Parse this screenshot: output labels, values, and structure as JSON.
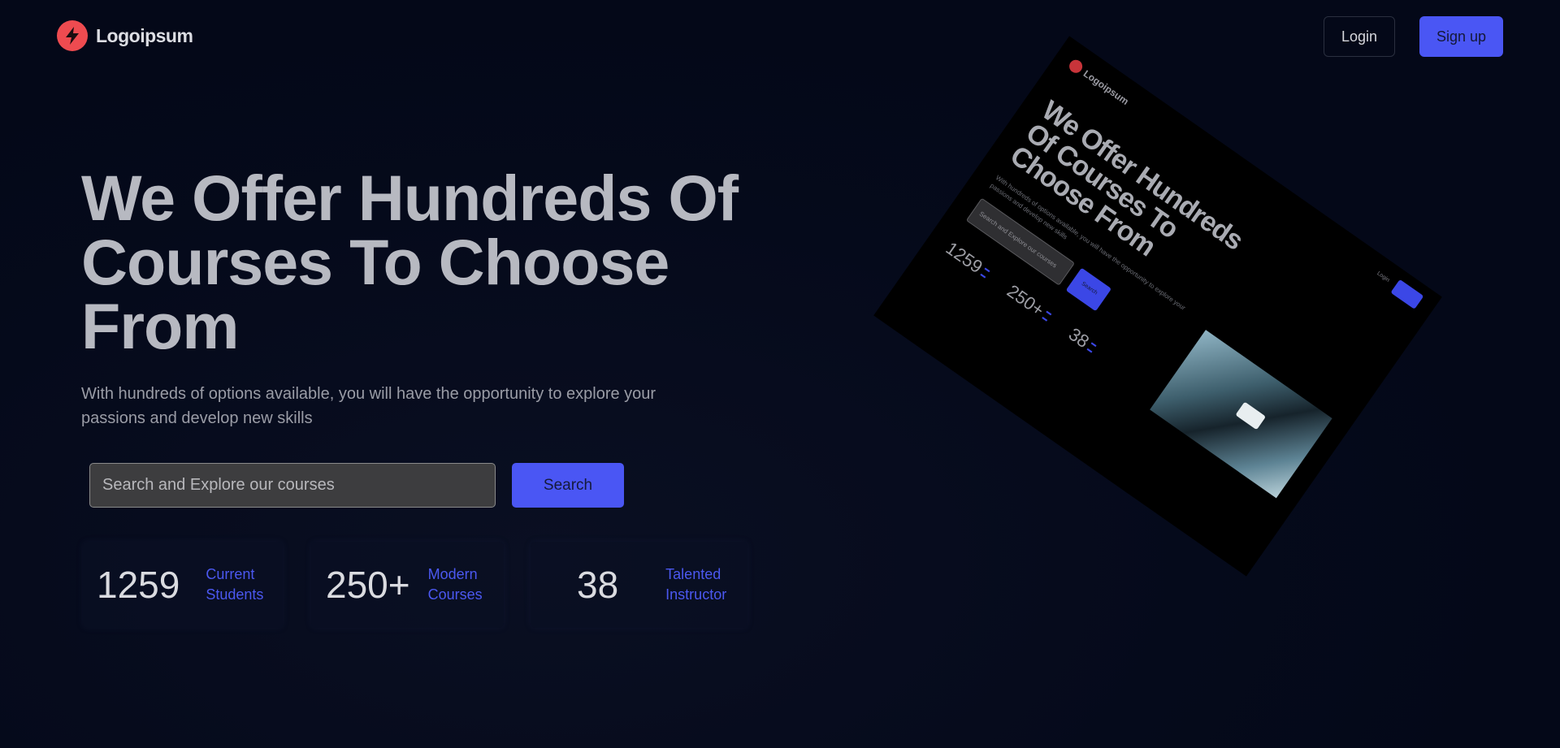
{
  "header": {
    "brand_name": "Logoipsum",
    "login_label": "Login",
    "signup_label": "Sign up"
  },
  "hero": {
    "title_line1": "We Offer Hundreds Of",
    "title_line2": "Courses To Choose",
    "title_line3": "From",
    "subtitle": "With hundreds of options available, you will have the opportunity to explore your passions and develop new skills",
    "search_placeholder": "Search and Explore our courses",
    "search_button": "Search"
  },
  "stats": [
    {
      "value": "1259",
      "label_line1": "Current",
      "label_line2": "Students"
    },
    {
      "value": "250+",
      "label_line1": "Modern",
      "label_line2": "Courses"
    },
    {
      "value": "38",
      "label_line1": "Talented",
      "label_line2": "Instructor"
    }
  ],
  "preview": {
    "brand_name": "Logoipsum",
    "login_label": "Login",
    "title": "We Offer Hundreds Of Courses To Choose From",
    "subtitle": "With hundreds of options available, you will have the opportunity to explore your passions and develop new skills",
    "search_placeholder": "Search and Explore our courses",
    "search_button": "Search",
    "stats": [
      "1259",
      "250+",
      "38"
    ]
  },
  "colors": {
    "background": "#040818",
    "accent": "#4a56f4",
    "brand_red": "#ee4b50",
    "title_text": "#b7b9c1"
  },
  "icons": {
    "brand": "lightning-bolt-icon"
  }
}
